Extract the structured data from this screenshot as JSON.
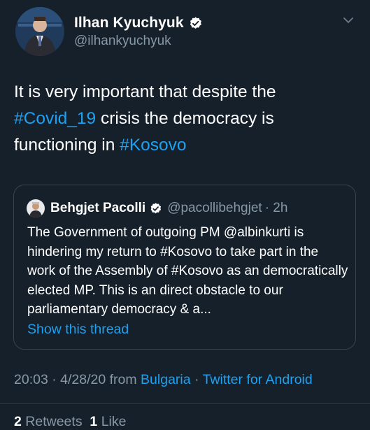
{
  "author": {
    "display_name": "Ilhan Kyuchyuk",
    "handle": "@ilhankyuchyuk",
    "verified_icon": "verified-badge-icon"
  },
  "tweet": {
    "text_1": "It is very important that despite the ",
    "hashtag_1": "#Covid_19",
    "text_2": " crisis the democracy is functioning in ",
    "hashtag_2": "#Kosovo"
  },
  "quoted_tweet": {
    "display_name": "Behgjet Pacolli",
    "handle": "@pacollibehgjet",
    "time": "· 2h",
    "body": "The Government of outgoing PM @albinkurti is hindering my return to #Kosovo to take part in the work of the Assembly of #Kosovo as an democratically elected MP. This is an direct obstacle to our parliamentary democracy & a...",
    "show_thread": "Show this thread"
  },
  "meta": {
    "time": "20:03",
    "date": "· 4/28/20 from ",
    "location": "Bulgaria",
    "sep": " · ",
    "source": "Twitter for Android"
  },
  "stats": {
    "retweets_count": "2",
    "retweets_label": "Retweets",
    "likes_count": "1",
    "likes_label": "Like"
  },
  "colors": {
    "background": "#15202b",
    "accent": "#1da1f2",
    "muted": "#8899a6"
  }
}
